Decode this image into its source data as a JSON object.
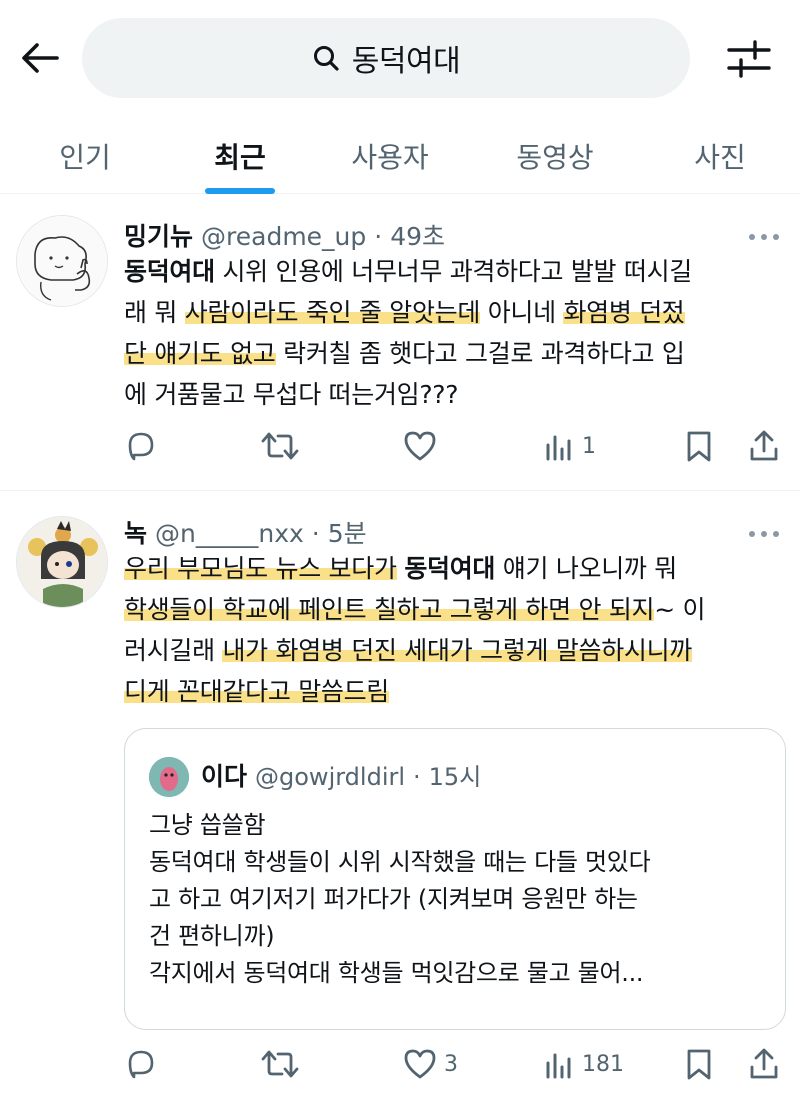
{
  "header": {
    "search_query": "동덕여대",
    "back_icon": "arrow-left-icon",
    "search_icon": "search-icon",
    "filter_icon": "sliders-icon"
  },
  "tabs": [
    {
      "label": "인기",
      "active": false
    },
    {
      "label": "최근",
      "active": true
    },
    {
      "label": "사용자",
      "active": false
    },
    {
      "label": "동영상",
      "active": false
    },
    {
      "label": "사진",
      "active": false
    }
  ],
  "accent_color": "#1d9bf0",
  "highlight_color": "#fbe08a",
  "posts": [
    {
      "name": "밍기뉴",
      "handle": "@readme_up",
      "dot": "·",
      "time": "49초",
      "text": {
        "l1_kw": "동덕여대",
        "l1_rest": " 시위 인용에 너무너무 과격하다고 발발 떠시길",
        "l2_a": "래 뭐 ",
        "l2_hl": "사람이라도 죽인 줄 알앗는데",
        "l2_b": " 아니네 ",
        "l2_hl2": "화염병 던젔",
        "l3_hl": "단 얘기도 없고",
        "l3_rest": " 락커칠 좀 햇다고 그걸로 과격하다고 입",
        "l4": "에 거품물고 무섭다 떠는거임???"
      },
      "stats": {
        "replies": "",
        "reposts": "",
        "likes": "",
        "views": "1"
      }
    },
    {
      "name": "녹",
      "handle": "@n_____nxx",
      "dot": "·",
      "time": "5분",
      "text": {
        "l1_hl": "우리 부모님도 뉴스 보다가",
        "l1_sp": " ",
        "l1_kw": "동덕여대",
        "l1_rest": " 얘기 나오니까 뭐",
        "l2_hl": "학생들이 학교에 페인트 칠하고 그렇게 하면 안 되지",
        "l2_rest": "~ 이",
        "l3_a": "러시길래 ",
        "l3_hl": "내가 화염병 던진 세대가 그렇게 말씀하시니까",
        "l4_hl": "디게 꼰대같다고 말씀드림"
      },
      "quote": {
        "name": "이다",
        "handle": "@gowjrdldirl",
        "dot": "·",
        "time": "15시",
        "lines": [
          "그냥 씁쓸함",
          "동덕여대 학생들이 시위 시작했을 때는 다들 멋있다",
          "고 하고 여기저기 퍼가다가 (지켜보며 응원만 하는",
          "건 편하니까)",
          "각지에서 동덕여대 학생들 먹잇감으로 물고 물어..."
        ]
      },
      "stats": {
        "replies": "",
        "reposts": "",
        "likes": "3",
        "views": "181"
      }
    }
  ]
}
